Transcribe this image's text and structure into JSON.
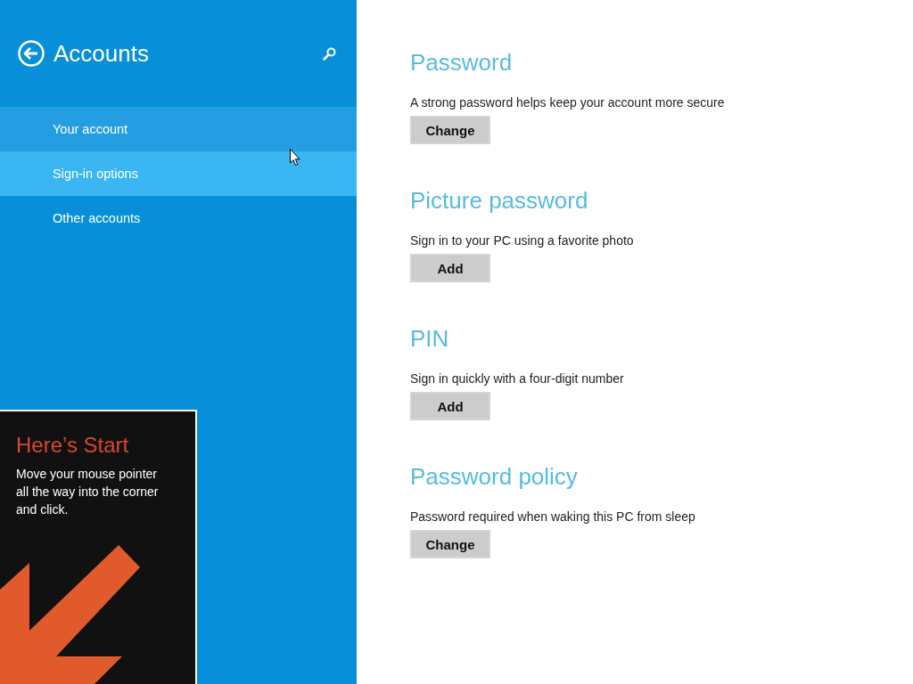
{
  "header": {
    "title": "Accounts"
  },
  "nav": {
    "items": [
      {
        "label": "Your account",
        "selected": false,
        "hovered": true
      },
      {
        "label": "Sign-in options",
        "selected": true,
        "hovered": false
      },
      {
        "label": "Other accounts",
        "selected": false,
        "hovered": false
      }
    ]
  },
  "tip": {
    "title": "Here’s Start",
    "body": "Move your mouse pointer all the way into the corner and click."
  },
  "sections": [
    {
      "heading": "Password",
      "description": "A strong password helps keep your account more secure",
      "button": "Change"
    },
    {
      "heading": "Picture password",
      "description": "Sign in to your PC using a favorite photo",
      "button": "Add"
    },
    {
      "heading": "PIN",
      "description": "Sign in quickly with a four-digit number",
      "button": "Add"
    },
    {
      "heading": "Password policy",
      "description": "Password required when waking this PC from sleep",
      "button": "Change"
    }
  ]
}
